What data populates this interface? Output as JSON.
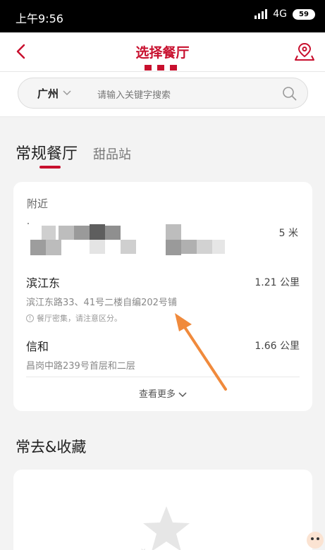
{
  "statusbar": {
    "time": "上午9:56",
    "network": "4G",
    "battery": "59"
  },
  "header": {
    "title": "选择餐厅"
  },
  "search": {
    "city": "广州",
    "placeholder": "请输入关键字搜索"
  },
  "tabs": {
    "regular": "常规餐厅",
    "dessert": "甜品站"
  },
  "nearby": {
    "label": "附近",
    "first_distance": "5 米",
    "restaurants": [
      {
        "name": "滨江东",
        "address": "滨江东路33、41号二楼自编202号铺",
        "note": "餐厅密集，请注意区分。",
        "distance": "1.21 公里"
      },
      {
        "name": "信和",
        "address": "昌岗中路239号首层和二层",
        "distance": "1.66 公里"
      }
    ],
    "more_label": "查看更多"
  },
  "favorites": {
    "title": "常去&收藏"
  },
  "colors": {
    "brand": "#c8102e",
    "annotation_arrow": "#f08a3c"
  }
}
